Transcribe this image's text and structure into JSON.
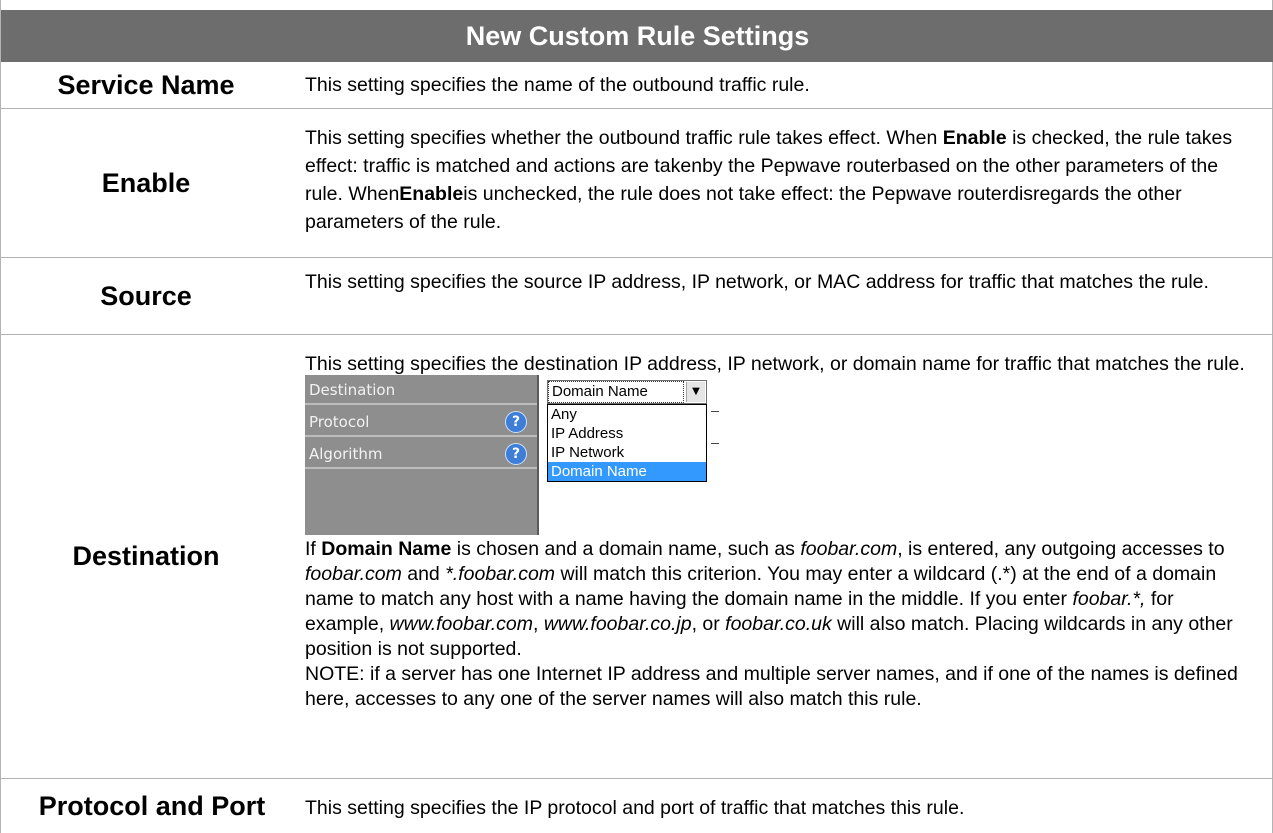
{
  "title": "New Custom Rule Settings",
  "rows": {
    "service_name": {
      "label": "Service Name",
      "desc": "This setting specifies the name of the outbound traffic rule."
    },
    "enable": {
      "label": "Enable",
      "p1": "This setting specifies whether the outbound traffic rule takes effect. When ",
      "b1": "Enable",
      "p2": " is checked, the rule takes effect: traffic is matched and actions are takenby the Pepwave routerbased on the other parameters of the rule. When",
      "b2": "Enable",
      "p3": "is unchecked, the rule does not take effect: the Pepwave routerdisregards the other parameters of the rule."
    },
    "source": {
      "label": "Source",
      "desc": "This setting specifies the source IP address, IP network, or MAC address for traffic that matches the rule."
    },
    "destination": {
      "label": "Destination",
      "intro": "This setting specifies the destination IP address, IP network, or domain name for traffic that matches the rule.",
      "screenshot": {
        "fields": [
          "Destination",
          "Protocol",
          "Algorithm"
        ],
        "selected": "Domain Name",
        "options": [
          "Any",
          "IP Address",
          "IP Network",
          "Domain Name"
        ]
      },
      "t1": "If ",
      "b1": "Domain Name",
      "t2": " is chosen and a domain name, such as ",
      "i1": "foobar.com",
      "t3": ", is entered, any outgoing accesses to ",
      "i2": "foobar.com",
      "t4": " and ",
      "i3": "*.foobar.com",
      "t5": " will match this criterion. You may enter a wildcard (.*) at the end of a domain name to match any host with a name having the domain name in the middle. If you enter ",
      "i4": "foobar.*,",
      "t6": " for example, ",
      "i5": "www.foobar.com",
      "t7": ", ",
      "i6": "www.foobar.co.jp",
      "t8": ", or ",
      "i7": "foobar.co.uk",
      "t9": " will also match. Placing wildcards in any other position is not supported.",
      "note": "NOTE: if a server has one Internet IP address and multiple server names, and if one of the names is defined here, accesses to any one of the server names will also match this rule."
    },
    "protocol_port": {
      "label": "Protocol and Port",
      "desc": "This setting specifies the IP protocol and port of traffic that matches this rule."
    }
  }
}
